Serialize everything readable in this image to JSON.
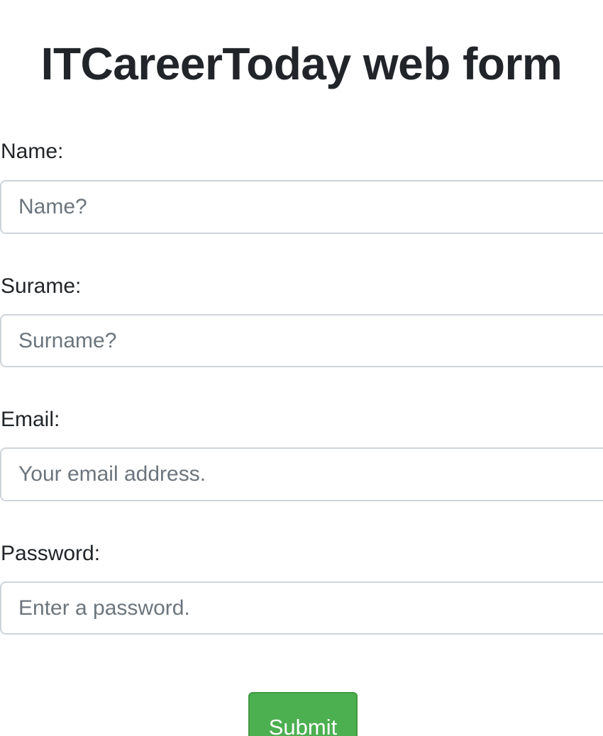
{
  "page": {
    "title": "ITCareerToday web form"
  },
  "form": {
    "name": {
      "label": "Name:",
      "placeholder": "Name?",
      "value": ""
    },
    "surname": {
      "label": "Surame:",
      "placeholder": "Surname?",
      "value": ""
    },
    "email": {
      "label": "Email:",
      "placeholder": "Your email address.",
      "value": ""
    },
    "password": {
      "label": "Password:",
      "placeholder": "Enter a password.",
      "value": ""
    },
    "submit_label": "Submit"
  },
  "colors": {
    "text": "#212529",
    "placeholder": "#6c757d",
    "input_border": "#ced4da",
    "submit_background": "#4caf50",
    "submit_text": "#ffffff"
  }
}
